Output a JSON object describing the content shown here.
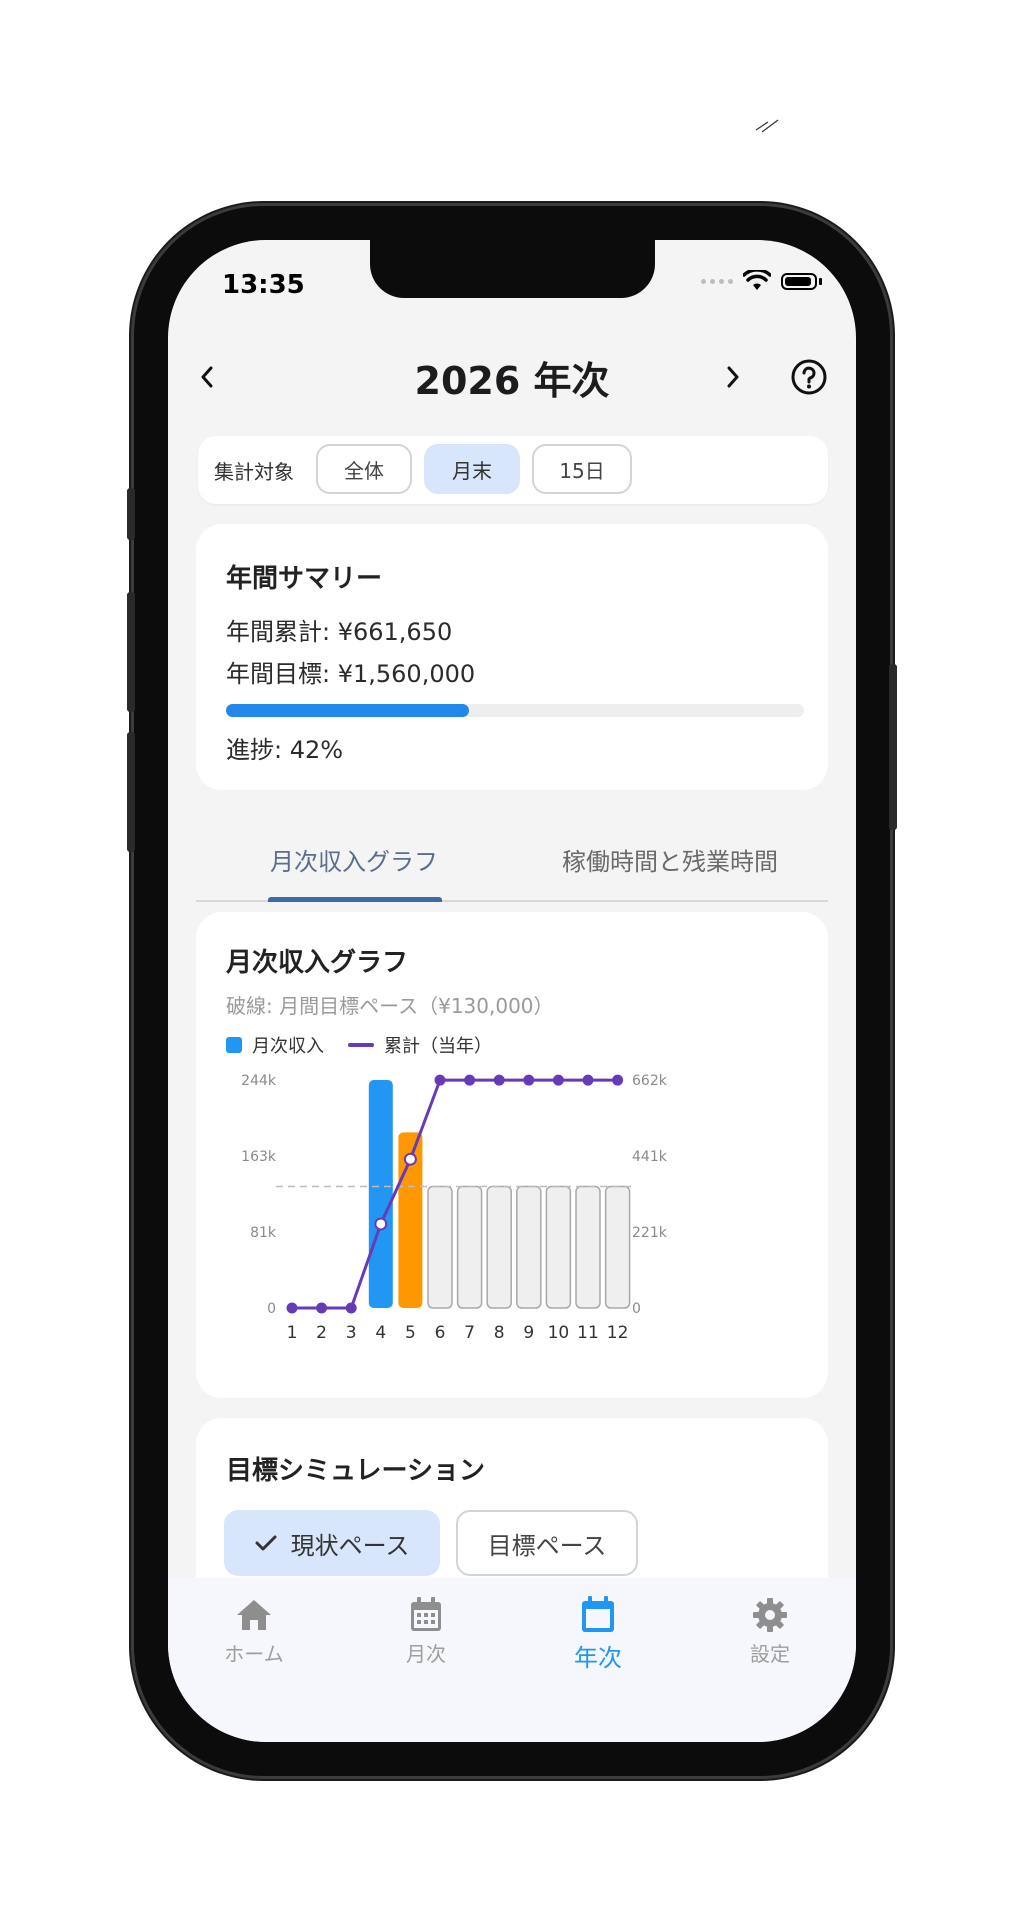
{
  "status": {
    "time": "13:35"
  },
  "header": {
    "title": "2026 年次"
  },
  "filter": {
    "label": "集計対象",
    "options": [
      "全体",
      "月末",
      "15日"
    ],
    "selected": "月末"
  },
  "summary": {
    "title": "年間サマリー",
    "total_line": "年間累計: ¥661,650",
    "goal_line": "年間目標: ¥1,560,000",
    "progress_line": "進捗: 42%",
    "progress_fraction": 0.42
  },
  "tabs": [
    {
      "label": "月次収入グラフ",
      "active": true
    },
    {
      "label": "稼働時間と残業時間",
      "active": false
    }
  ],
  "chart_card": {
    "title": "月次収入グラフ",
    "subtitle": "破線: 月間目標ペース（¥130,000）",
    "legend": [
      "月次収入",
      "累計（当年）"
    ]
  },
  "chart_data": {
    "type": "bar",
    "categories": [
      "1",
      "2",
      "3",
      "4",
      "5",
      "6",
      "7",
      "8",
      "9",
      "10",
      "11",
      "12"
    ],
    "series": [
      {
        "name": "月次収入",
        "values": [
          0,
          0,
          0,
          244000,
          188000,
          130000,
          130000,
          130000,
          130000,
          130000,
          130000,
          130000
        ]
      },
      {
        "name": "累計（当年）",
        "values": [
          0,
          0,
          0,
          244000,
          432000,
          661650,
          661650,
          661650,
          661650,
          661650,
          661650,
          661650
        ]
      }
    ],
    "bar_states": [
      "actual",
      "actual",
      "actual",
      "actual",
      "highlight",
      "projected",
      "projected",
      "projected",
      "projected",
      "projected",
      "projected",
      "projected"
    ],
    "left_ticks": [
      "0",
      "81k",
      "163k",
      "244k"
    ],
    "right_ticks": [
      "0",
      "221k",
      "441k",
      "662k"
    ],
    "ylim_left": [
      0,
      244000
    ],
    "ylim_right": [
      0,
      662000
    ],
    "target_line": 130000,
    "colors": {
      "actual": "#2196f3",
      "highlight": "#ff9800",
      "projected": "#efefef",
      "cumulative": "#673ab7"
    }
  },
  "simulation": {
    "title": "目標シミュレーション",
    "options": [
      "現状ペース",
      "目標ペース"
    ],
    "selected": "現状ペース"
  },
  "nav": [
    {
      "label": "ホーム",
      "icon": "home-icon",
      "active": false
    },
    {
      "label": "月次",
      "icon": "calendar-grid-icon",
      "active": false
    },
    {
      "label": "年次",
      "icon": "calendar-icon",
      "active": true
    },
    {
      "label": "設定",
      "icon": "gear-icon",
      "active": false
    }
  ]
}
